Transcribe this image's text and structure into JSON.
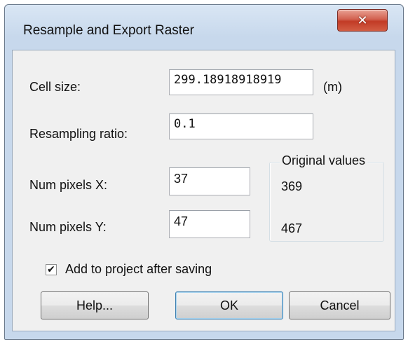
{
  "window": {
    "title": "Resample and Export Raster",
    "close_icon": "close-icon"
  },
  "form": {
    "cell_size": {
      "label": "Cell size:",
      "value": "299.18918918919",
      "unit": "(m)"
    },
    "resampling_ratio": {
      "label": "Resampling ratio:",
      "value": "0.1"
    },
    "num_pixels_x": {
      "label": "Num pixels X:",
      "value": "37"
    },
    "num_pixels_y": {
      "label": "Num pixels Y:",
      "value": "47"
    }
  },
  "original_values": {
    "title": "Original values",
    "x": "369",
    "y": "467"
  },
  "add_to_project": {
    "label": "Add to project after saving",
    "checked": true
  },
  "buttons": {
    "help": "Help...",
    "ok": "OK",
    "cancel": "Cancel"
  }
}
